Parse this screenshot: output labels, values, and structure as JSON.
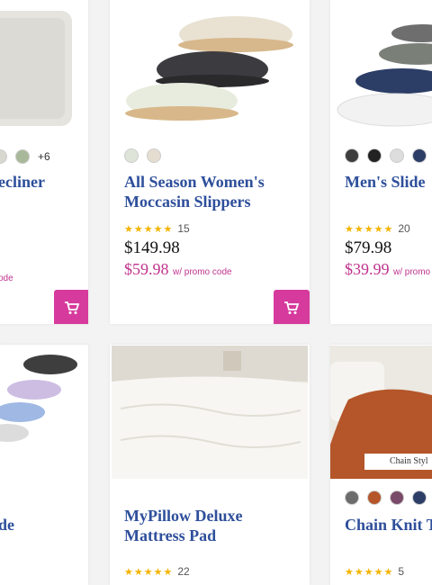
{
  "products": [
    {
      "title": "ecliner",
      "more_colors": "+6",
      "promo_suffix": "ode",
      "swatches": [
        "#d8d8d0",
        "#a8b89a"
      ]
    },
    {
      "title": "All Season Women's Moccasin Slippers",
      "reviews": "15",
      "price": "$149.98",
      "promo_price": "$59.98",
      "promo_suffix": "w/ promo code",
      "swatches": [
        "#dfe4d8",
        "#e5ddd0"
      ]
    },
    {
      "title": "Men's Slide",
      "reviews": "20",
      "price": "$79.98",
      "promo_price": "$39.99",
      "promo_suffix": "w/ promo",
      "swatches": [
        "#3e3e3e",
        "#222222",
        "#dddddd",
        "#2c3d66"
      ]
    },
    {
      "title": "de"
    },
    {
      "title": "MyPillow Deluxe Mattress Pad",
      "reviews": "22"
    },
    {
      "title": "Chain Knit T Blankets",
      "reviews": "5",
      "image_label": "Chain Styl",
      "swatches": [
        "#6c6c6c",
        "#b4562a",
        "#7a4a6a",
        "#2d3e66"
      ]
    }
  ],
  "colors": {
    "accent": "#d63a9d",
    "title": "#2e4f9b",
    "star": "#f4b400"
  }
}
